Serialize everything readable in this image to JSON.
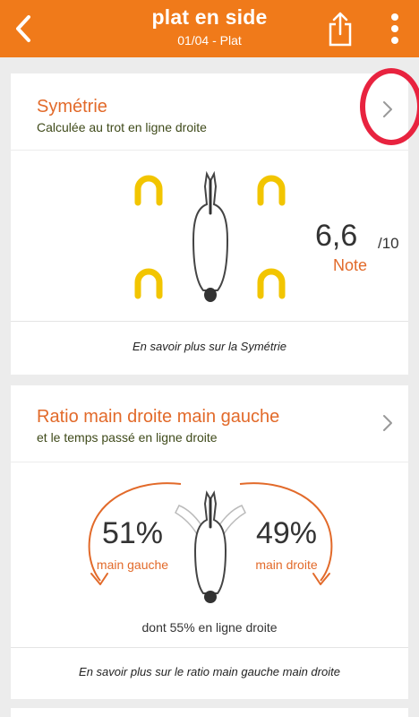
{
  "header": {
    "title": "plat en side",
    "subtitle": "01/04 - Plat",
    "bg_color": "#f07a1a"
  },
  "symmetry": {
    "title": "Symétrie",
    "subtitle": "Calculée au trot en ligne droite",
    "score": "6,6",
    "score_max": "/10",
    "score_label": "Note",
    "link": "En savoir plus sur la Symétrie",
    "icons": [
      "horseshoe-icon",
      "horse-top-view-icon",
      "chevron-right-icon"
    ]
  },
  "ratio": {
    "title": "Ratio main droite main gauche",
    "subtitle": "et le temps passé en ligne droite",
    "left_percent": "51%",
    "left_label": "main gauche",
    "right_percent": "49%",
    "right_label": "main droite",
    "straight_line_note": "dont 55% en ligne droite",
    "link": "En savoir plus sur le ratio main gauche main droite",
    "left_value": 51,
    "right_value": 49,
    "straight_value": 55
  },
  "colors": {
    "accent": "#e26a2a",
    "horseshoe": "#f2c500",
    "annotation": "#e8233f"
  }
}
